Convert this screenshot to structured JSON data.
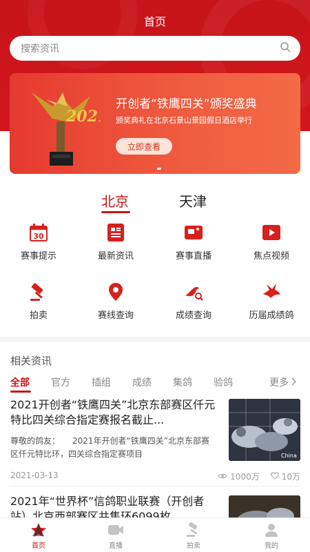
{
  "header": {
    "title": "首页"
  },
  "search": {
    "placeholder": "搜索资讯"
  },
  "banner": {
    "title": "开创者“铁鹰四关”颁奖盛典",
    "subtitle": "颁奖典礼在北京石景山景园假日酒店举行",
    "button": "立即查看"
  },
  "city_tabs": [
    {
      "label": "北京",
      "active": true
    },
    {
      "label": "天津",
      "active": false
    }
  ],
  "quick_menu": [
    {
      "label": "赛事提示",
      "icon": "calendar-icon",
      "badge": "30"
    },
    {
      "label": "最新资讯",
      "icon": "news-icon"
    },
    {
      "label": "赛事直播",
      "icon": "live-camera-icon"
    },
    {
      "label": "焦点视频",
      "icon": "video-play-icon"
    },
    {
      "label": "拍卖",
      "icon": "auction-hammer-icon"
    },
    {
      "label": "赛线查询",
      "icon": "location-pin-icon"
    },
    {
      "label": "成绩查询",
      "icon": "pigeon-search-icon"
    },
    {
      "label": "历届成绩鸽",
      "icon": "flying-pigeon-icon"
    }
  ],
  "news": {
    "section_title": "相关资讯",
    "categories": [
      "全部",
      "官方",
      "插组",
      "成绩",
      "集鸽",
      "验鸽"
    ],
    "more": "更多",
    "articles": [
      {
        "title": "2021开创者“铁鹰四关”北京东部赛区仟元特比四关综合指定赛报名截止...",
        "desc": "尊敬的鸽友：　　2021年开创者“铁鹰四关”北京东部赛区仟元特比环，四关综合指定赛项目",
        "date": "2021-03-13",
        "views": "1000万",
        "likes": "10万",
        "image_caption": "China"
      },
      {
        "title": "2021年“世界杯”信鸽职业联赛（开创者站）北京西部赛区共集环6099枚"
      }
    ]
  },
  "tabbar": [
    {
      "label": "首页",
      "icon": "home-star-icon",
      "active": true
    },
    {
      "label": "直播",
      "icon": "live-camera-icon",
      "active": false
    },
    {
      "label": "拍卖",
      "icon": "auction-hammer-icon",
      "active": false
    },
    {
      "label": "我的",
      "icon": "user-icon",
      "active": false
    }
  ],
  "colors": {
    "brand": "#c8141b",
    "banner": "#ef5a3e"
  }
}
